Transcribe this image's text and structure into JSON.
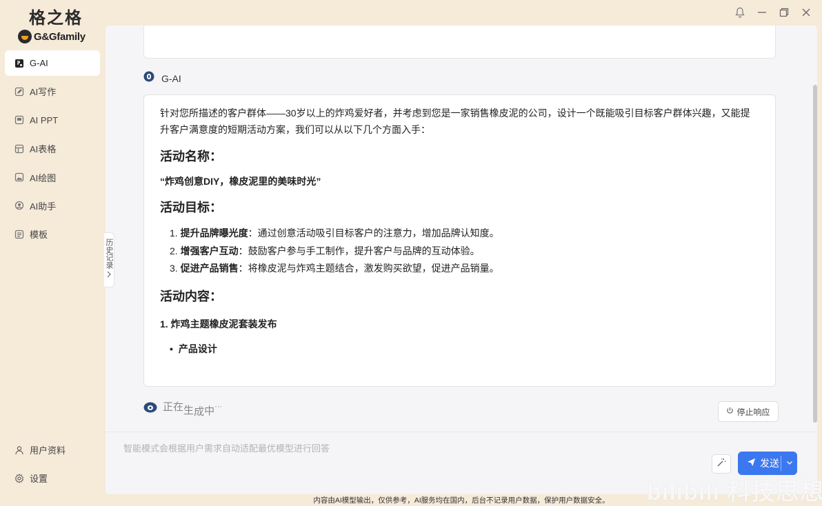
{
  "app": {
    "logo_cn": "格之格",
    "logo_en": "G&Gfamily"
  },
  "sidebar": {
    "items": [
      {
        "label": "G-AI",
        "icon": "g-ai-icon",
        "active": true
      },
      {
        "label": "AI写作",
        "icon": "pen-icon"
      },
      {
        "label": "AI PPT",
        "icon": "ppt-icon"
      },
      {
        "label": "AI表格",
        "icon": "table-icon"
      },
      {
        "label": "AI绘图",
        "icon": "image-icon"
      },
      {
        "label": "AI助手",
        "icon": "assistant-icon"
      },
      {
        "label": "模板",
        "icon": "template-icon"
      }
    ],
    "bottom": [
      {
        "label": "用户资料",
        "icon": "user-icon"
      },
      {
        "label": "设置",
        "icon": "gear-icon"
      }
    ]
  },
  "history_tab": {
    "label": "历史记录"
  },
  "chat": {
    "ai_name": "G-AI",
    "intro": "针对您所描述的客户群体——30岁以上的炸鸡爱好者，并考虑到您是一家销售橡皮泥的公司，设计一个既能吸引目标客户群体兴趣，又能提升客户满意度的短期活动方案，我们可以从以下几个方面入手：",
    "h_name": "活动名称：",
    "activity_name": "“炸鸡创意DIY，橡皮泥里的美味时光”",
    "h_goal": "活动目标：",
    "goals": [
      {
        "num": "1.",
        "title": "提升品牌曝光度",
        "text": "：通过创意活动吸引目标客户的注意力，增加品牌认知度。"
      },
      {
        "num": "2.",
        "title": "增强客户互动",
        "text": "：鼓励客户参与手工制作，提升客户与品牌的互动体验。"
      },
      {
        "num": "3.",
        "title": "促进产品销售",
        "text": "：将橡皮泥与炸鸡主题结合，激发购买欲望，促进产品销量。"
      }
    ],
    "h_content": "活动内容：",
    "content_1": "1. 炸鸡主题橡皮泥套装发布",
    "content_1_bullet": "产品设计",
    "generating": [
      "正",
      "在",
      "生",
      "成",
      "中",
      "···"
    ],
    "stop_label": "停止响应"
  },
  "input": {
    "placeholder": "智能模式会根据用户需求自动适配最优模型进行回答",
    "value": ""
  },
  "send_label": "发送",
  "footer_note": "内容由AI模型输出，仅供参考，AI服务均在国内，后台不记录用户数据，保护用户数据安全。",
  "watermark": "bilibili 科技思想",
  "colors": {
    "accent": "#3b78f0",
    "window_bg": "#f6ead9",
    "panel_bg": "#f5f5f7"
  }
}
